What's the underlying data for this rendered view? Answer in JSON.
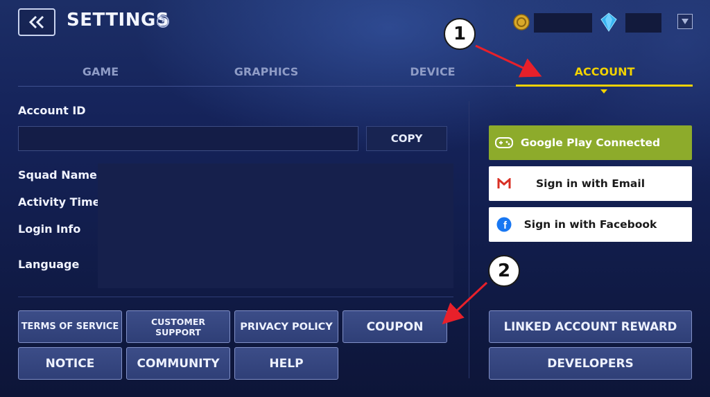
{
  "header": {
    "title": "SETTINGS",
    "help_symbol": "?",
    "back_icon": "double-chevron-left-icon",
    "currencies": [
      {
        "icon": "gold-coin-icon",
        "value_hidden": true
      },
      {
        "icon": "blue-diamond-icon",
        "value_hidden": true
      }
    ],
    "dropdown_icon": "triangle-down-icon"
  },
  "tabs": [
    {
      "label": "GAME",
      "active": false
    },
    {
      "label": "GRAPHICS",
      "active": false
    },
    {
      "label": "DEVICE",
      "active": false
    },
    {
      "label": "ACCOUNT",
      "active": true
    }
  ],
  "account": {
    "id_label": "Account ID",
    "id_value": "",
    "copy_label": "COPY",
    "fields": [
      {
        "label": "Squad Name"
      },
      {
        "label": "Activity Time"
      },
      {
        "label": "Login Info"
      },
      {
        "label": "Language"
      }
    ]
  },
  "login_options": [
    {
      "label": "Google Play Connected",
      "icon": "gamepad-icon"
    },
    {
      "label": "Sign in with Email",
      "icon": "gmail-icon"
    },
    {
      "label": "Sign in with Facebook",
      "icon": "facebook-icon"
    }
  ],
  "menu": {
    "row1": [
      "TERMS OF SERVICE",
      "CUSTOMER SUPPORT",
      "PRIVACY POLICY",
      "COUPON"
    ],
    "row2": [
      "NOTICE",
      "COMMUNITY",
      "HELP"
    ],
    "right": [
      "LINKED ACCOUNT REWARD",
      "DEVELOPERS"
    ]
  },
  "annotations": [
    "1",
    "2"
  ],
  "colors": {
    "accent": "#f2d200",
    "google_green": "#8dab2b",
    "annotation_arrow": "#e8202a"
  }
}
